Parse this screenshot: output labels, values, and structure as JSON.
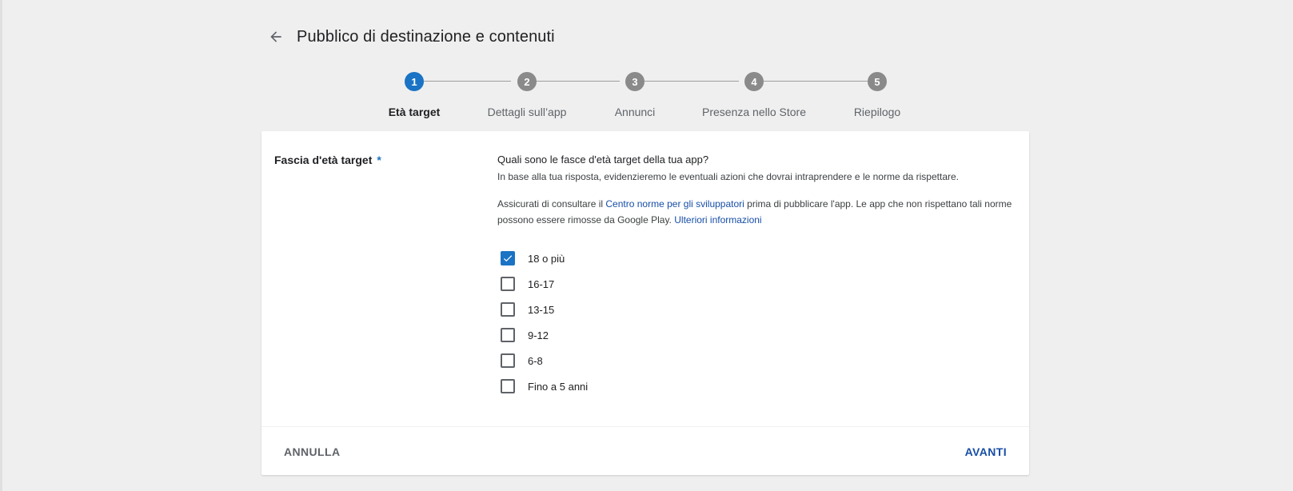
{
  "header": {
    "title": "Pubblico di destinazione e contenuti",
    "back_icon": "arrow-back-icon"
  },
  "stepper": {
    "active_step": 1,
    "steps": [
      {
        "number": "1",
        "label": "Età target"
      },
      {
        "number": "2",
        "label": "Dettagli sull’app"
      },
      {
        "number": "3",
        "label": "Annunci"
      },
      {
        "number": "4",
        "label": "Presenza nello Store"
      },
      {
        "number": "5",
        "label": "Riepilogo"
      }
    ]
  },
  "form": {
    "field_label": "Fascia d'età target",
    "required_mark": "*",
    "question": "Quali sono le fasce d'età target della tua app?",
    "hint": "In base alla tua risposta, evidenzieremo le eventuali azioni che dovrai intraprendere e le norme da rispettare.",
    "policy": {
      "text_before": "Assicurati di consultare il ",
      "link1": "Centro norme per gli sviluppatori",
      "text_middle": " prima di pubblicare l'app. Le app che non rispettano tali norme possono essere rimosse da Google Play. ",
      "link2": "Ulteriori informazioni"
    },
    "options": [
      {
        "label": "18 o più",
        "checked": true
      },
      {
        "label": "16-17",
        "checked": false
      },
      {
        "label": "13-15",
        "checked": false
      },
      {
        "label": "9-12",
        "checked": false
      },
      {
        "label": "6-8",
        "checked": false
      },
      {
        "label": "Fino a 5 anni",
        "checked": false
      }
    ]
  },
  "footer": {
    "cancel_label": "ANNULLA",
    "next_label": "AVANTI"
  },
  "colors": {
    "accent": "#1a73c4",
    "link": "#174ea6",
    "step_inactive": "#8a8a8a",
    "background": "#efefef"
  }
}
